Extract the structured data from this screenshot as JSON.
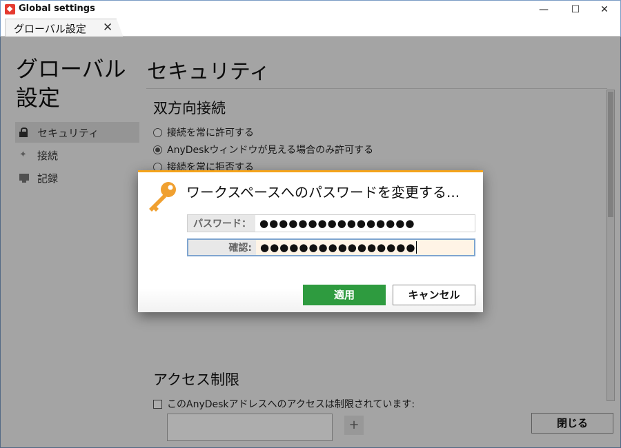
{
  "window": {
    "title": "Global settings",
    "minimize": "—",
    "maximize": "☐",
    "close": "✕",
    "logo_icon": "anydesk-logo-icon"
  },
  "tab": {
    "label": "グローバル設定",
    "close": "✕"
  },
  "sidebar": {
    "title": "グローバル設定",
    "items": [
      {
        "label": "セキュリティ",
        "icon": "lock-icon",
        "active": true
      },
      {
        "label": "接続",
        "icon": "plug-icon",
        "active": false
      },
      {
        "label": "記録",
        "icon": "monitor-icon",
        "active": false
      }
    ]
  },
  "main": {
    "section_title": "セキュリティ",
    "bidirectional": {
      "title": "双方向接続",
      "options": [
        {
          "label": "接続を常に許可する",
          "checked": false
        },
        {
          "label": "AnyDeskウィンドウが見える場合のみ許可する",
          "checked": true
        },
        {
          "label": "接続を常に拒否する",
          "checked": false
        }
      ]
    },
    "access": {
      "title": "アクセス制限",
      "checkbox_label": "このAnyDeskアドレスへのアクセスは制限されています:",
      "add_button": "+"
    },
    "close_button": "閉じる"
  },
  "dialog": {
    "title": "ワークスペースへのパスワードを変更する...",
    "icon": "key-icon",
    "password_label": "パスワード：",
    "password_value": "●●●●●●●●●●●●●●●●",
    "confirm_label": "確認:",
    "confirm_value": "●●●●●●●●●●●●●●●●",
    "apply_button": "適用",
    "cancel_button": "キャンセル"
  },
  "colors": {
    "accent_orange": "#f5a31a",
    "apply_green": "#2e9b3f",
    "logo_red": "#e53a2f"
  }
}
